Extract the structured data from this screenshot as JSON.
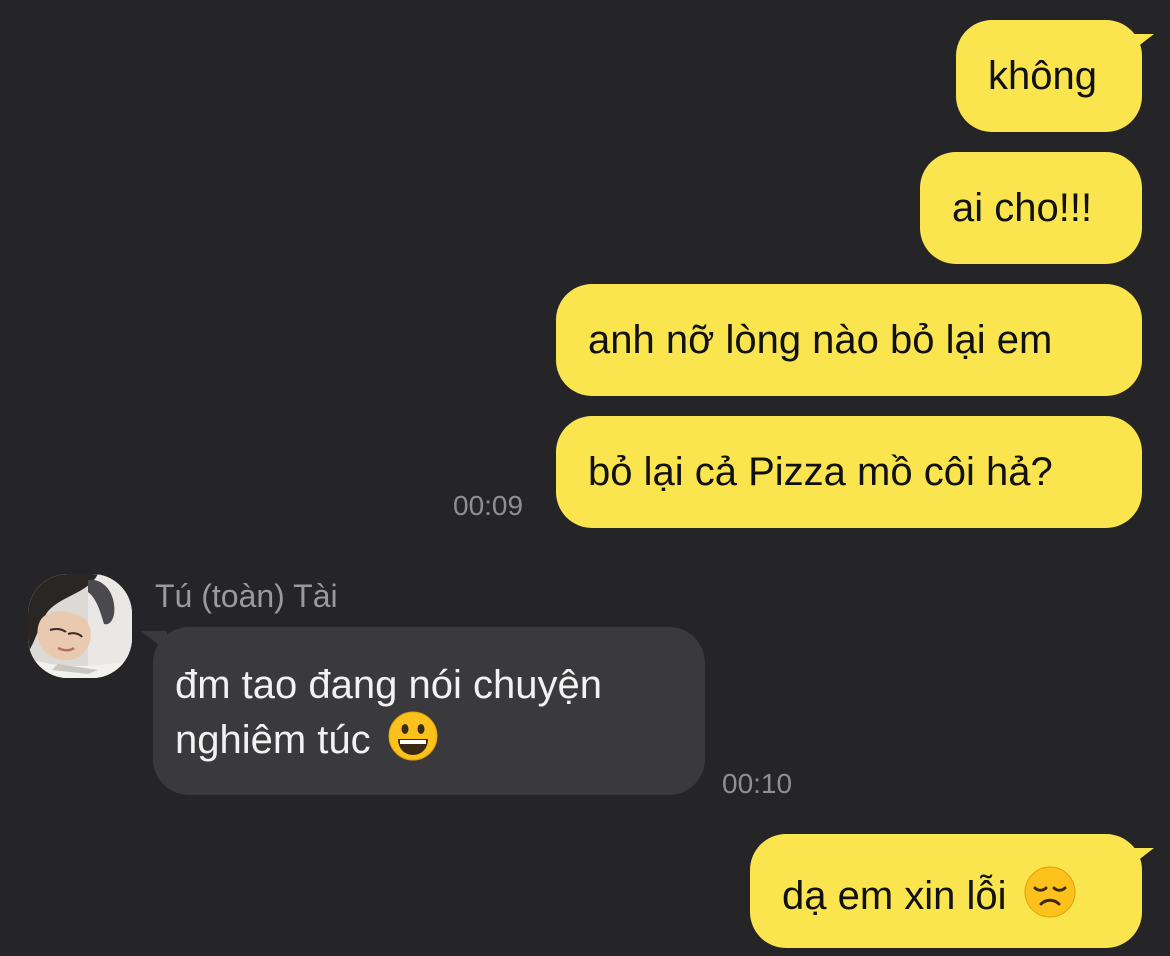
{
  "messages_out_1": "không",
  "messages_out_2": "ai cho!!!",
  "messages_out_3": "anh nỡ lòng nào bỏ lại em",
  "messages_out_4": "bỏ lại cả Pizza mồ côi hả?",
  "time_out_1": "00:09",
  "sender_name": "Tú (toàn) Tài",
  "incoming_line1": "đm tao đang nói chuyện",
  "incoming_line2": "nghiêm túc",
  "incoming_emoji": "grinning-face",
  "time_in_1": "00:10",
  "messages_out_5": "dạ em xin lỗi",
  "out5_emoji": "disappointed-face",
  "colors": {
    "background": "#252527",
    "outgoing_bubble": "#fbe54f",
    "incoming_bubble": "#3a3a3c",
    "timestamp": "#8e8e93"
  }
}
